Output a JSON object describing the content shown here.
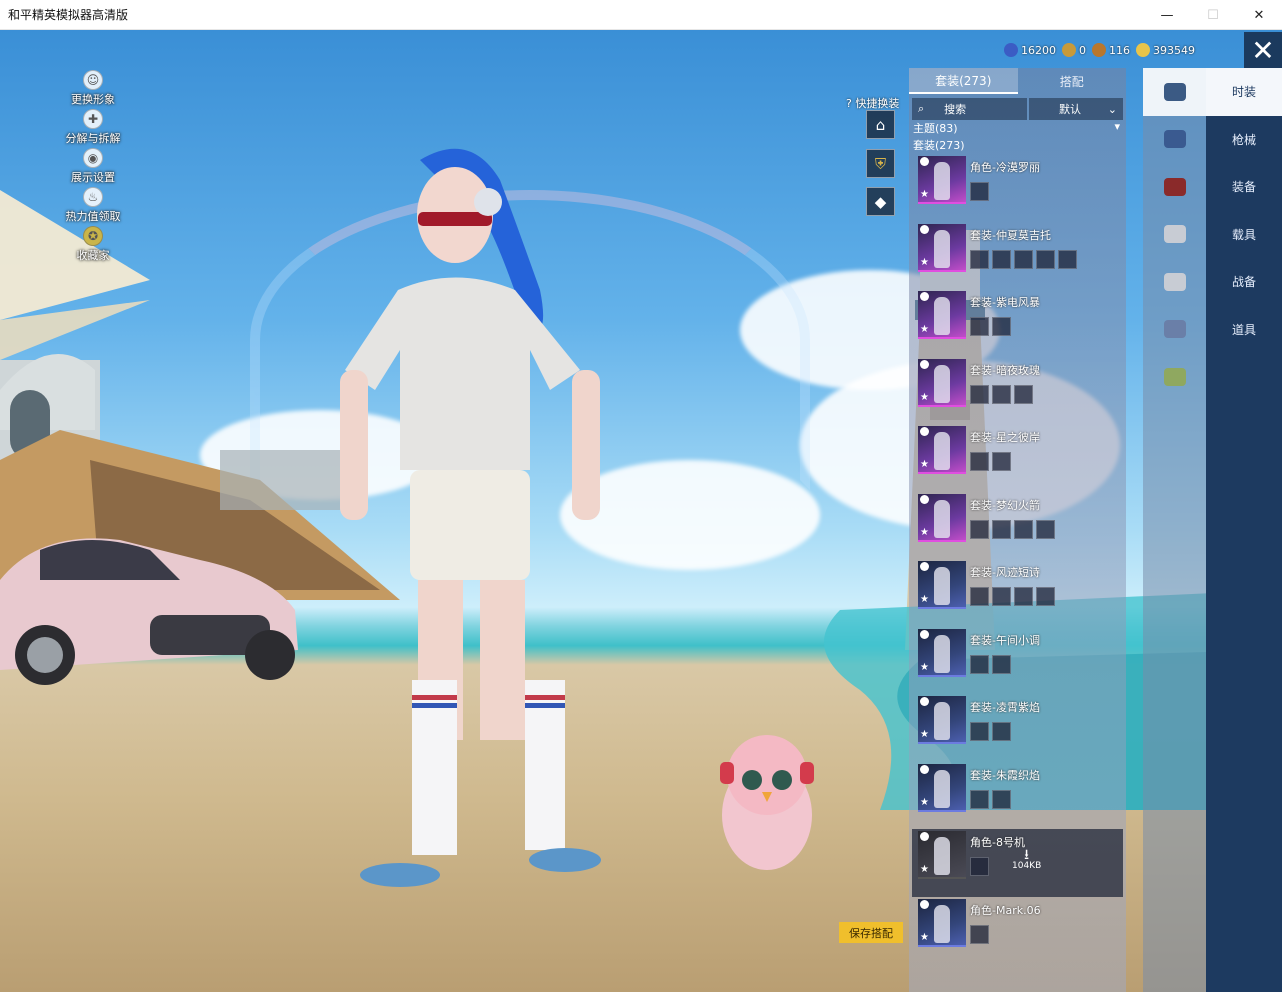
{
  "window": {
    "title": "和平精英模拟器高清版",
    "minimize": "—",
    "maximize": "☐",
    "close": "✕"
  },
  "left_menu": [
    {
      "label": "更换形象",
      "icon": "person-icon"
    },
    {
      "label": "分解与拆解",
      "icon": "puzzle-icon"
    },
    {
      "label": "展示设置",
      "icon": "eye-icon"
    },
    {
      "label": "热力值领取",
      "icon": "flame-icon"
    },
    {
      "label": "收藏家",
      "icon": "badge-icon"
    }
  ],
  "quick_swap": {
    "label": "快捷换装"
  },
  "currency": [
    {
      "value": "16200",
      "color": "#3b5cc4"
    },
    {
      "value": "0",
      "color": "#c89a3a"
    },
    {
      "value": "116",
      "color": "#b9772c"
    },
    {
      "value": "393549",
      "color": "#e8c44a"
    }
  ],
  "panel": {
    "tabs": [
      {
        "label": "套装(273)",
        "active": true
      },
      {
        "label": "搭配",
        "active": false
      }
    ],
    "search_label": "搜索",
    "sort_label": "默认",
    "theme_line": "主题(83)",
    "suit_line": "套装(273)",
    "items": [
      {
        "name": "角色-冷漠罗丽",
        "parts": 1,
        "style": "pink"
      },
      {
        "name": "套装-仲夏莫吉托",
        "parts": 5,
        "style": "pink"
      },
      {
        "name": "套装-紫电风暴",
        "parts": 2,
        "style": "pink"
      },
      {
        "name": "套装-暗夜玫瑰",
        "parts": 3,
        "style": "pink"
      },
      {
        "name": "套装-星之彼岸",
        "parts": 2,
        "style": "pink"
      },
      {
        "name": "套装-梦幻火箭",
        "parts": 4,
        "style": "pink"
      },
      {
        "name": "套装-风迹短诗",
        "parts": 4,
        "style": "blue"
      },
      {
        "name": "套装-午间小调",
        "parts": 2,
        "style": "blue"
      },
      {
        "name": "套装-凌霄紫焰",
        "parts": 2,
        "style": "blue"
      },
      {
        "name": "套装-朱霞织焰",
        "parts": 2,
        "style": "blue"
      },
      {
        "name": "角色-8号机",
        "parts": 1,
        "style": "grey",
        "selected": true,
        "download_size": "104KB"
      },
      {
        "name": "角色-Mark.06",
        "parts": 1,
        "style": "blue"
      }
    ],
    "save_button": "保存搭配"
  },
  "icon_column": [
    {
      "icon": "outfit-icon",
      "active": true,
      "color": "#d8e2ef"
    },
    {
      "icon": "gun-icon",
      "active": false,
      "color": "#3a5a90"
    },
    {
      "icon": "helmet-icon",
      "active": false,
      "color": "#8a2a2a"
    },
    {
      "icon": "mask-icon",
      "active": false,
      "color": "#c8ccd4"
    },
    {
      "icon": "jacket-icon",
      "active": false,
      "color": "#c8ccd4"
    },
    {
      "icon": "figure-icon",
      "active": false,
      "color": "#6a7fa8"
    },
    {
      "icon": "parachute-icon",
      "active": false,
      "color": "#8fa860"
    }
  ],
  "categories": [
    {
      "label": "时装",
      "active": true
    },
    {
      "label": "枪械",
      "active": false
    },
    {
      "label": "装备",
      "active": false
    },
    {
      "label": "载具",
      "active": false
    },
    {
      "label": "战备",
      "active": false
    },
    {
      "label": "道具",
      "active": false
    }
  ]
}
